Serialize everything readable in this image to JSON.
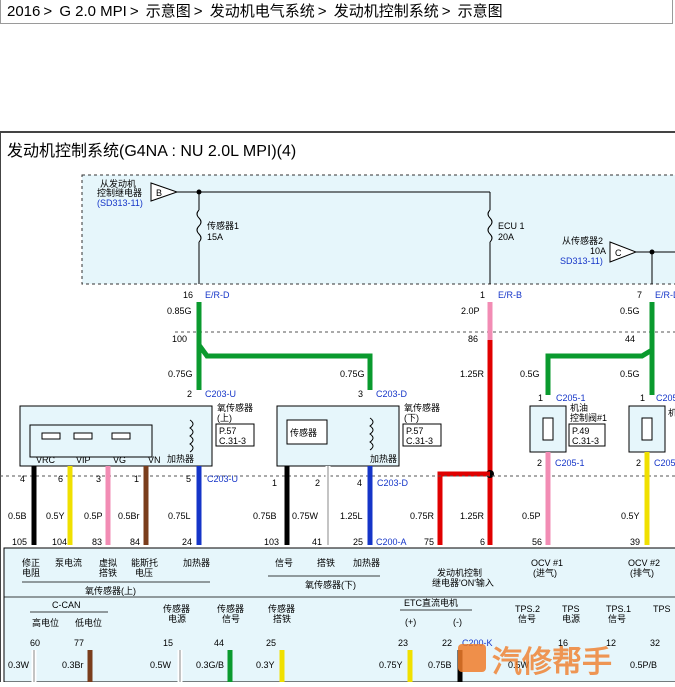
{
  "breadcrumb": {
    "items": [
      "2016",
      "G 2.0 MPI",
      "示意图",
      "发动机电气系统",
      "发动机控制系统",
      "示意图"
    ],
    "separator": ">"
  },
  "sheet_title": "发动机控制系统(G4NA : NU 2.0L MPI)(4)",
  "fuse_box": {
    "relay_label_1": "从发动机",
    "relay_label_2": "控制继电器",
    "relay_ref": "(SD313-11)",
    "relay_b": "B",
    "fuse1_name": "传感器1",
    "fuse1_rating": "15A",
    "ecu_name": "ECU 1",
    "ecu_rating": "20A",
    "fuse2_name": "从传感器2",
    "fuse2_rating": "10A",
    "fuse2_ref": "SD313-11)",
    "relay_c": "C"
  },
  "wires": {
    "w16": "16",
    "w16_conn": "E/R-D",
    "w16_spec": "0.85G",
    "w1": "1",
    "w1_conn": "E/R-B",
    "w1_spec": "2.0P",
    "w7": "7",
    "w7_conn": "E/R-D",
    "w7_spec": "0.5G",
    "j100": "100",
    "j86": "86",
    "j44": "44",
    "g075a": "0.75G",
    "g075b": "0.75G",
    "r125": "1.25R",
    "g05a": "0.5G",
    "g05b": "0.5G",
    "c203u_pin": "2",
    "c203u": "C203-U",
    "c203d_pin": "3",
    "c203d": "C203-D",
    "c205_pin": "1",
    "c205": "C205-1",
    "c205b_pin": "1",
    "c205b": "C205"
  },
  "sensor_up": {
    "label": "氧传感器",
    "sub": "(上)",
    "ref1": "P.57",
    "ref2": "C.31-3",
    "heater": "加热器",
    "pins": [
      "VRC",
      "VIP",
      "VG",
      "VN"
    ],
    "pin_nums": [
      "4",
      "6",
      "3",
      "1",
      "5"
    ],
    "out_conn": "C203-U",
    "specs": [
      "0.5B",
      "0.5Y",
      "0.5P",
      "0.5Br",
      "0.75L"
    ],
    "ecm_pins": [
      "105",
      "104",
      "83",
      "84",
      "24"
    ]
  },
  "sensor_down": {
    "label": "氧传感器",
    "sub": "(下)",
    "ref1": "P.57",
    "ref2": "C.31-3",
    "sensor": "传感器",
    "heater": "加热器",
    "pin_nums": [
      "1",
      "2",
      "4"
    ],
    "out_conn": "C203-D",
    "specs": [
      "0.75B",
      "0.75W",
      "1.25L"
    ],
    "ecm_pins": [
      "103",
      "41",
      "25"
    ],
    "ecm_conn": "C200-A"
  },
  "mid": {
    "spec_a": "0.75R",
    "spec_b": "1.25R",
    "pin_a": "75",
    "pin_b": "6"
  },
  "ocv1": {
    "label1": "机油",
    "label2": "控制阀#1",
    "ref1": "P.49",
    "ref2": "C.31-3",
    "pin": "2",
    "conn": "C205-1",
    "spec": "0.5P",
    "ecm_pin": "56"
  },
  "ocv2": {
    "label": "机",
    "pin": "2",
    "conn": "C205",
    "spec": "0.5Y",
    "ecm_pin": "39"
  },
  "ecm_labels": {
    "a1": "修正",
    "a2": "电阻",
    "b1": "泵电流",
    "c1": "虚拟",
    "c2": "搭铁",
    "d1": "能斯托",
    "d2": "电压",
    "e1": "加热器",
    "f1": "信号",
    "g1": "搭铁",
    "h1": "加热器",
    "up_group": "氧传感器(上)",
    "down_group": "氧传感器(下)",
    "relay1": "发动机控制",
    "relay2": "继电器'ON'输入",
    "ocv1_1": "OCV #1",
    "ocv1_2": "(进气)",
    "ocv2_1": "OCV #2",
    "ocv2_2": "(排气)"
  },
  "bottom": {
    "can": "C-CAN",
    "can_hi": "高电位",
    "can_lo": "低电位",
    "s1a": "传感器",
    "s1b": "电源",
    "s2a": "传感器",
    "s2b": "信号",
    "s3a": "传感器",
    "s3b": "搭铁",
    "etc": "ETC直流电机",
    "plus": "(+)",
    "minus": "(-)",
    "tps2a": "TPS.2",
    "tps2b": "信号",
    "tpsa": "TPS",
    "tpsb": "电源",
    "tps1a": "TPS.1",
    "tps1b": "信号",
    "tps_last": "TPS",
    "pins": [
      "60",
      "77",
      "15",
      "44",
      "25",
      "23",
      "22",
      "16",
      "12",
      "32"
    ],
    "conn_k": "C200-K",
    "specs": [
      "0.3W",
      "0.3Br",
      "0.5W",
      "0.3G/B",
      "0.3Y",
      "0.75Y",
      "0.75B",
      "0.5W",
      "0.5P/B"
    ]
  },
  "watermark": "汽修帮手",
  "colors": {
    "green": "#0a9a2e",
    "red": "#e00000",
    "pink": "#f28cb4",
    "blue": "#1535c8",
    "yellow": "#f0e000",
    "brown": "#7a3d1c",
    "black": "#000000",
    "white": "#ffffff",
    "dash_box": "#e6f6fb",
    "ecm_box": "#e6f6fb",
    "ref_text": "#1535c8"
  }
}
